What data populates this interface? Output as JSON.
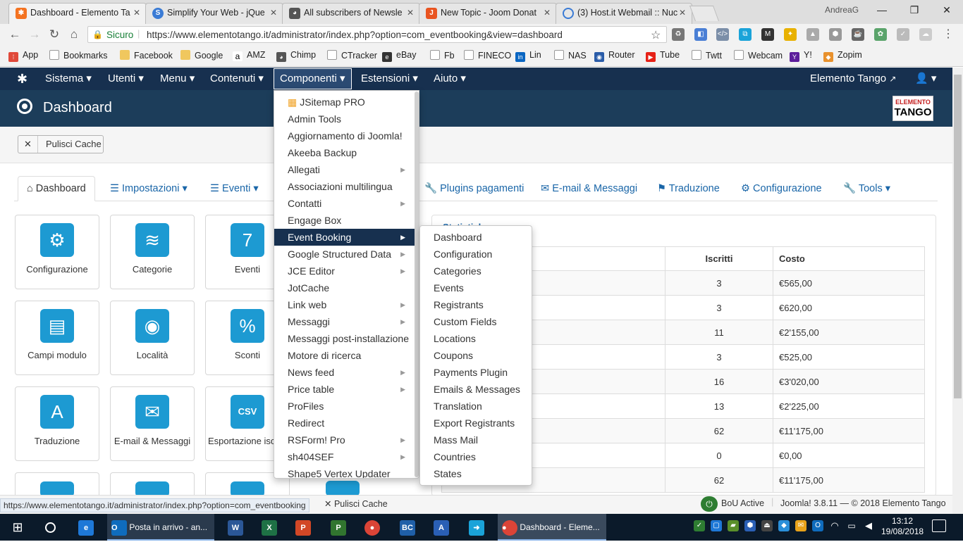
{
  "browser": {
    "tabs": [
      {
        "title": "Dashboard - Elemento Ta",
        "favicon": "joomla-icon"
      },
      {
        "title": "Simplify Your Web - jQue",
        "favicon": "syw-icon"
      },
      {
        "title": "All subscribers of Newsle",
        "favicon": "monkey-icon"
      },
      {
        "title": "New Topic - Joom Donat",
        "favicon": "joom-icon"
      },
      {
        "title": "(3) Host.it Webmail :: Nuc",
        "favicon": "loading-icon"
      }
    ],
    "profile": "AndreaG",
    "secure_label": "Sicuro",
    "url": "https://www.elementotango.it/administrator/index.php?option=com_eventbooking&view=dashboard",
    "bookmarks": [
      "App",
      "Bookmarks",
      "Facebook",
      "Google",
      "AMZ",
      "Chimp",
      "CTracker",
      "eBay",
      "Fb",
      "FINECO",
      "Lin",
      "NAS",
      "Router",
      "Tube",
      "Twtt",
      "Webcam",
      "Y!",
      "Zopim"
    ]
  },
  "joomla": {
    "menu": [
      "Sistema",
      "Utenti",
      "Menu",
      "Contenuti",
      "Componenti",
      "Estensioni",
      "Aiuto"
    ],
    "site_link": "Elemento Tango",
    "page_title": "Dashboard",
    "logo_text": [
      "ELEMENTO",
      "TANGO"
    ],
    "toolbar": {
      "clear_cache": "Pulisci Cache"
    },
    "tabs": [
      "Dashboard",
      "Impostazioni",
      "Eventi",
      "Plugins pagamenti",
      "E-mail & Messaggi",
      "Traduzione",
      "Configurazione",
      "Tools"
    ],
    "tiles": [
      "Configurazione",
      "Categorie",
      "Eventi",
      "Campi modulo",
      "Località",
      "Sconti",
      "Traduzione",
      "E-mail & Messaggi",
      "Esportazione isc"
    ],
    "tile_eventi_number": "7",
    "tile_csv_label": "CSV",
    "stats": {
      "title": "Statistiche",
      "headers": [
        "Iscritti",
        "Costo"
      ],
      "rows": [
        [
          "3",
          "€565,00"
        ],
        [
          "3",
          "€620,00"
        ],
        [
          "11",
          "€2'155,00"
        ],
        [
          "3",
          "€525,00"
        ],
        [
          "16",
          "€3'020,00"
        ],
        [
          "13",
          "€2'225,00"
        ],
        [
          "62",
          "€11'175,00"
        ],
        [
          "0",
          "€0,00"
        ],
        [
          "62",
          "€11'175,00"
        ]
      ]
    },
    "components_menu": [
      {
        "label": "JSitemap PRO",
        "sub": false
      },
      {
        "label": "Admin Tools",
        "sub": false
      },
      {
        "label": "Aggiornamento di Joomla!",
        "sub": false
      },
      {
        "label": "Akeeba Backup",
        "sub": false
      },
      {
        "label": "Allegati",
        "sub": true
      },
      {
        "label": "Associazioni multilingua",
        "sub": false
      },
      {
        "label": "Contatti",
        "sub": true
      },
      {
        "label": "Engage Box",
        "sub": false
      },
      {
        "label": "Event Booking",
        "sub": true
      },
      {
        "label": "Google Structured Data",
        "sub": true
      },
      {
        "label": "JCE Editor",
        "sub": true
      },
      {
        "label": "JotCache",
        "sub": false
      },
      {
        "label": "Link web",
        "sub": true
      },
      {
        "label": "Messaggi",
        "sub": true
      },
      {
        "label": "Messaggi post-installazione",
        "sub": false
      },
      {
        "label": "Motore di ricerca",
        "sub": false
      },
      {
        "label": "News feed",
        "sub": true
      },
      {
        "label": "Price table",
        "sub": true
      },
      {
        "label": "ProFiles",
        "sub": false
      },
      {
        "label": "Redirect",
        "sub": false
      },
      {
        "label": "RSForm! Pro",
        "sub": true
      },
      {
        "label": "sh404SEF",
        "sub": true
      },
      {
        "label": "Shape5 Vertex Updater",
        "sub": false
      }
    ],
    "eventbooking_menu": [
      "Dashboard",
      "Configuration",
      "Categories",
      "Events",
      "Registrants",
      "Custom Fields",
      "Locations",
      "Coupons",
      "Payments Plugin",
      "Emails & Messages",
      "Translation",
      "Export Registrants",
      "Mass Mail",
      "Countries",
      "States"
    ],
    "footer": {
      "status_url": "https://www.elementotango.it/administrator/index.php?option=com_eventbooking",
      "clear_cache": "Pulisci Cache",
      "bou": "BoU Active",
      "version": "Joomla! 3.8.11 — © 2018 Elemento Tango"
    }
  },
  "taskbar": {
    "outlook": "Posta in arrivo - an...",
    "chrome": "Dashboard - Eleme...",
    "time": "13:12",
    "date": "19/08/2018"
  }
}
